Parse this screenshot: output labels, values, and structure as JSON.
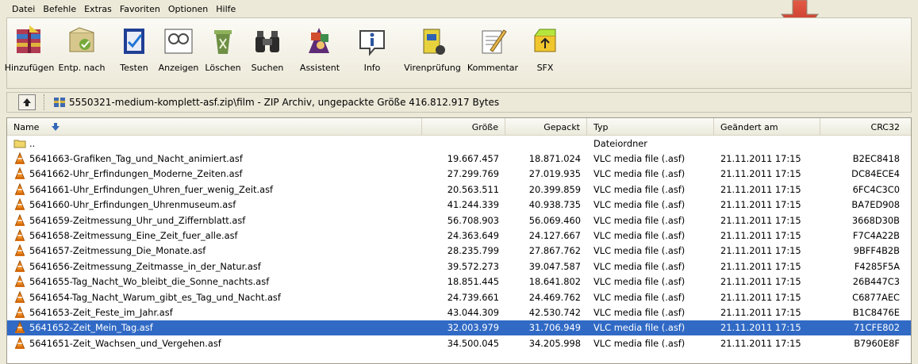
{
  "menu": [
    "Datei",
    "Befehle",
    "Extras",
    "Favoriten",
    "Optionen",
    "Hilfe"
  ],
  "toolbar": [
    {
      "label": "Hinzufügen",
      "icon": "add-archive-icon"
    },
    {
      "label": "Entp. nach",
      "icon": "extract-to-icon"
    },
    {
      "label": "Testen",
      "icon": "test-icon"
    },
    {
      "label": "Anzeigen",
      "icon": "view-icon"
    },
    {
      "label": "Löschen",
      "icon": "delete-icon"
    },
    {
      "label": "Suchen",
      "icon": "find-icon"
    },
    {
      "label": "Assistent",
      "icon": "wizard-icon"
    },
    {
      "label": "Info",
      "icon": "info-icon"
    },
    {
      "label": "Virenprüfung",
      "icon": "virus-scan-icon"
    },
    {
      "label": "Kommentar",
      "icon": "comment-icon"
    },
    {
      "label": "SFX",
      "icon": "sfx-icon"
    }
  ],
  "address": {
    "path": "5550321-medium-komplett-asf.zip\\film - ZIP Archiv, ungepackte Größe 416.812.917 Bytes"
  },
  "columns": {
    "name": "Name",
    "size": "Größe",
    "packed": "Gepackt",
    "type": "Typ",
    "modified": "Geändert am",
    "crc": "CRC32"
  },
  "rows": [
    {
      "name": "..",
      "size": "",
      "packed": "",
      "type": "Dateiordner",
      "modified": "",
      "crc": "",
      "icon": "folder",
      "selected": false
    },
    {
      "name": "5641663-Grafiken_Tag_und_Nacht_animiert.asf",
      "size": "19.667.457",
      "packed": "18.871.024",
      "type": "VLC media file (.asf)",
      "modified": "21.11.2011 17:15",
      "crc": "B2EC8418",
      "icon": "vlc",
      "selected": false
    },
    {
      "name": "5641662-Uhr_Erfindungen_Moderne_Zeiten.asf",
      "size": "27.299.769",
      "packed": "27.019.935",
      "type": "VLC media file (.asf)",
      "modified": "21.11.2011 17:15",
      "crc": "DC84ECE4",
      "icon": "vlc",
      "selected": false
    },
    {
      "name": "5641661-Uhr_Erfindungen_Uhren_fuer_wenig_Zeit.asf",
      "size": "20.563.511",
      "packed": "20.399.859",
      "type": "VLC media file (.asf)",
      "modified": "21.11.2011 17:15",
      "crc": "6FC4C3C0",
      "icon": "vlc",
      "selected": false
    },
    {
      "name": "5641660-Uhr_Erfindungen_Uhrenmuseum.asf",
      "size": "41.244.339",
      "packed": "40.938.735",
      "type": "VLC media file (.asf)",
      "modified": "21.11.2011 17:15",
      "crc": "BA7ED908",
      "icon": "vlc",
      "selected": false
    },
    {
      "name": "5641659-Zeitmessung_Uhr_und_Ziffernblatt.asf",
      "size": "56.708.903",
      "packed": "56.069.460",
      "type": "VLC media file (.asf)",
      "modified": "21.11.2011 17:15",
      "crc": "3668D30B",
      "icon": "vlc",
      "selected": false
    },
    {
      "name": "5641658-Zeitmessung_Eine_Zeit_fuer_alle.asf",
      "size": "24.363.649",
      "packed": "24.127.667",
      "type": "VLC media file (.asf)",
      "modified": "21.11.2011 17:15",
      "crc": "F7C4A22B",
      "icon": "vlc",
      "selected": false
    },
    {
      "name": "5641657-Zeitmessung_Die_Monate.asf",
      "size": "28.235.799",
      "packed": "27.867.762",
      "type": "VLC media file (.asf)",
      "modified": "21.11.2011 17:15",
      "crc": "9BFF4B2B",
      "icon": "vlc",
      "selected": false
    },
    {
      "name": "5641656-Zeitmessung_Zeitmasse_in_der_Natur.asf",
      "size": "39.572.273",
      "packed": "39.047.587",
      "type": "VLC media file (.asf)",
      "modified": "21.11.2011 17:15",
      "crc": "F4285F5A",
      "icon": "vlc",
      "selected": false
    },
    {
      "name": "5641655-Tag_Nacht_Wo_bleibt_die_Sonne_nachts.asf",
      "size": "18.851.445",
      "packed": "18.641.802",
      "type": "VLC media file (.asf)",
      "modified": "21.11.2011 17:15",
      "crc": "26B447C3",
      "icon": "vlc",
      "selected": false
    },
    {
      "name": "5641654-Tag_Nacht_Warum_gibt_es_Tag_und_Nacht.asf",
      "size": "24.739.661",
      "packed": "24.469.762",
      "type": "VLC media file (.asf)",
      "modified": "21.11.2011 17:15",
      "crc": "C6877AEC",
      "icon": "vlc",
      "selected": false
    },
    {
      "name": "5641653-Zeit_Feste_im_Jahr.asf",
      "size": "43.044.309",
      "packed": "42.530.742",
      "type": "VLC media file (.asf)",
      "modified": "21.11.2011 17:15",
      "crc": "B1C8476E",
      "icon": "vlc",
      "selected": false
    },
    {
      "name": "5641652-Zeit_Mein_Tag.asf",
      "size": "32.003.979",
      "packed": "31.706.949",
      "type": "VLC media file (.asf)",
      "modified": "21.11.2011 17:15",
      "crc": "71CFE802",
      "icon": "vlc",
      "selected": true
    },
    {
      "name": "5641651-Zeit_Wachsen_und_Vergehen.asf",
      "size": "34.500.045",
      "packed": "34.205.998",
      "type": "VLC media file (.asf)",
      "modified": "21.11.2011 17:15",
      "crc": "B7960E8F",
      "icon": "vlc",
      "selected": false
    }
  ],
  "colors": {
    "selection": "#316ac5",
    "window": "#ece9d8",
    "arrow": "#d44a36"
  }
}
